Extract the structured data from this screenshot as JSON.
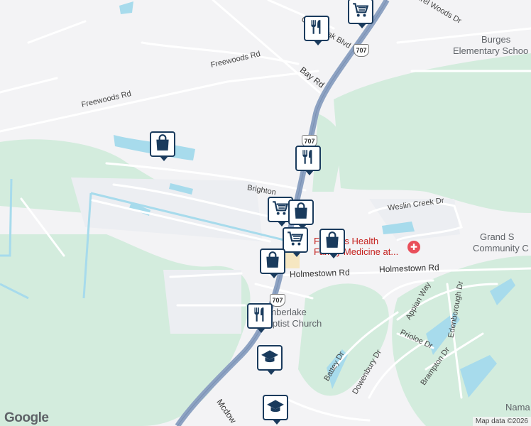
{
  "roads": {
    "laurel_woods": "Laurel Woods Dr",
    "green_oak": "Green Oak Blvd",
    "freewoods_rd_upper": "Freewoods Rd",
    "freewoods_rd_lower": "Freewoods Rd",
    "bay_rd": "Bay Rd",
    "brighton": "Brighton",
    "weslin_creek": "Weslin Creek Dr",
    "holmestown_left": "Holmestown Rd",
    "holmestown_right": "Holmestown Rd",
    "appian_way": "Appian Way",
    "edenborough": "Edenborough Dr",
    "prioloe": "Prioloe Dr",
    "battey": "Battey Dr",
    "dowenbury": "Dowenbury Dr",
    "brampton": "Brampton Dr",
    "mcdowell": "Mcdow"
  },
  "shields": {
    "hwy707": "707"
  },
  "places": {
    "burgess_school_1": "Burges",
    "burgess_school_2": "Elementary Schoo",
    "grand_strand_1": "Grand S",
    "grand_strand_2": "Community C",
    "health_1": "Fo  lands Health",
    "health_2": "Family Medicine at...",
    "church_1": "Timberlake",
    "church_2": "Baptist Church",
    "nama": "Nama"
  },
  "pins": [
    {
      "kind": "restaurant-icon"
    },
    {
      "kind": "grocery-cart-icon"
    },
    {
      "kind": "shopping-bag-icon"
    },
    {
      "kind": "restaurant-icon"
    },
    {
      "kind": "grocery-cart-icon"
    },
    {
      "kind": "shopping-bag-icon"
    },
    {
      "kind": "grocery-cart-icon"
    },
    {
      "kind": "shopping-bag-icon"
    },
    {
      "kind": "shopping-bag-icon"
    },
    {
      "kind": "restaurant-icon"
    },
    {
      "kind": "school-cap-icon"
    },
    {
      "kind": "school-cap-icon"
    }
  ],
  "branding": {
    "logo": "Google"
  },
  "attribution": "Map data ©2026",
  "colors": {
    "highway": "#8da2c2",
    "green_area": "#d3ecdd",
    "water": "#a7dbec",
    "pin_border": "#1a3b5d",
    "hospital": "#e94f5a"
  }
}
